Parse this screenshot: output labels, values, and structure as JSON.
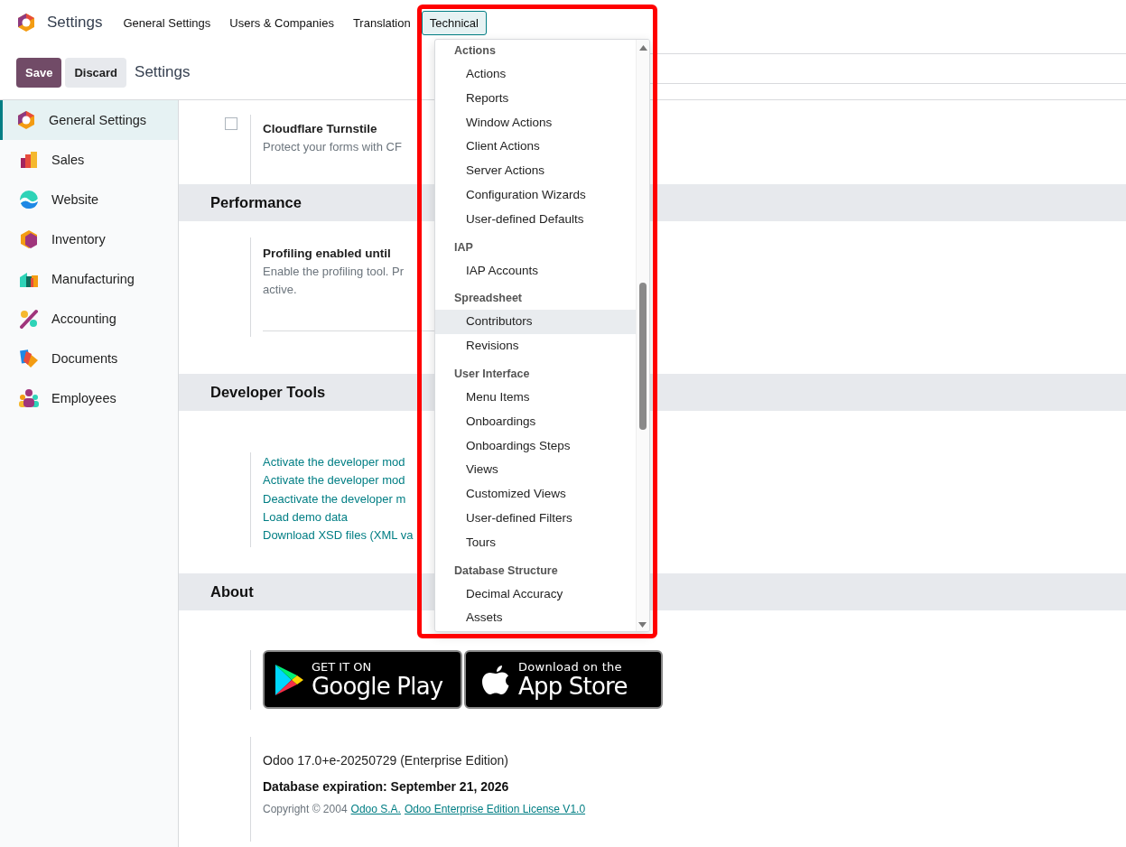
{
  "topbar": {
    "app_title": "Settings",
    "menu": [
      {
        "label": "General Settings",
        "selected": false
      },
      {
        "label": "Users & Companies",
        "selected": false
      },
      {
        "label": "Translation",
        "selected": false
      },
      {
        "label": "Technical",
        "selected": true
      }
    ]
  },
  "control_panel": {
    "buttons": [
      {
        "label": "Save",
        "kind": "primary"
      },
      {
        "label": "Discard",
        "kind": "secondary"
      }
    ],
    "breadcrumb": "Settings"
  },
  "sidebar": {
    "items": [
      {
        "label": "General Settings",
        "selected": true,
        "kind": "settings"
      },
      {
        "label": "Sales",
        "selected": false,
        "kind": "sales"
      },
      {
        "label": "Website",
        "selected": false,
        "kind": "website"
      },
      {
        "label": "Inventory",
        "selected": false,
        "kind": "inventory"
      },
      {
        "label": "Manufacturing",
        "selected": false,
        "kind": "manufacturing"
      },
      {
        "label": "Accounting",
        "selected": false,
        "kind": "accounting"
      },
      {
        "label": "Documents",
        "selected": false,
        "kind": "documents"
      },
      {
        "label": "Employees",
        "selected": false,
        "kind": "employees"
      }
    ]
  },
  "content": [
    {
      "kind": "setting",
      "checked": false,
      "title": "Cloudflare Turnstile",
      "description": [
        "Protect your forms with CF"
      ]
    },
    {
      "kind": "section",
      "title": "Performance"
    },
    {
      "kind": "setting",
      "title": "Profiling enabled until",
      "description": [
        "Enable the profiling tool. Pr",
        "active."
      ],
      "underline": true
    },
    {
      "kind": "section",
      "title": "Developer Tools"
    },
    {
      "kind": "links",
      "links": [
        "Activate the developer mod",
        "Activate the developer mod",
        "Deactivate the developer m",
        "Load demo data",
        "Download XSD files (XML va"
      ]
    },
    {
      "kind": "section",
      "title": "About"
    },
    {
      "kind": "badges",
      "badges": [
        {
          "kind": "google",
          "small": "GET IT ON",
          "big": "Google Play"
        },
        {
          "kind": "apple",
          "small": "Download on the",
          "big": "App Store"
        }
      ]
    },
    {
      "kind": "about",
      "version": "Odoo 17.0+e-20250729 (Enterprise Edition)",
      "expiration": "Database expiration: September 21, 2026",
      "copyright": "Copyright © 2004",
      "links": [
        "Odoo S.A.",
        "Odoo Enterprise Edition License V1.0"
      ]
    }
  ],
  "dropdown": {
    "groups": [
      {
        "header": "Actions",
        "items": [
          {
            "label": "Actions",
            "selected": false
          },
          {
            "label": "Reports",
            "selected": false
          },
          {
            "label": "Window Actions",
            "selected": false
          },
          {
            "label": "Client Actions",
            "selected": false
          },
          {
            "label": "Server Actions",
            "selected": false
          },
          {
            "label": "Configuration Wizards",
            "selected": false
          },
          {
            "label": "User-defined Defaults",
            "selected": false
          }
        ]
      },
      {
        "header": "IAP",
        "items": [
          {
            "label": "IAP Accounts",
            "selected": false
          }
        ]
      },
      {
        "header": "Spreadsheet",
        "items": [
          {
            "label": "Contributors",
            "selected": true
          },
          {
            "label": "Revisions",
            "selected": false
          }
        ]
      },
      {
        "header": "User Interface",
        "items": [
          {
            "label": "Menu Items",
            "selected": false
          },
          {
            "label": "Onboardings",
            "selected": false
          },
          {
            "label": "Onboardings Steps",
            "selected": false
          },
          {
            "label": "Views",
            "selected": false
          },
          {
            "label": "Customized Views",
            "selected": false
          },
          {
            "label": "User-defined Filters",
            "selected": false
          },
          {
            "label": "Tours",
            "selected": false
          }
        ]
      },
      {
        "header": "Database Structure",
        "items": [
          {
            "label": "Decimal Accuracy",
            "selected": false
          },
          {
            "label": "Assets",
            "selected": false
          }
        ]
      }
    ]
  },
  "highlight_frame": true
}
